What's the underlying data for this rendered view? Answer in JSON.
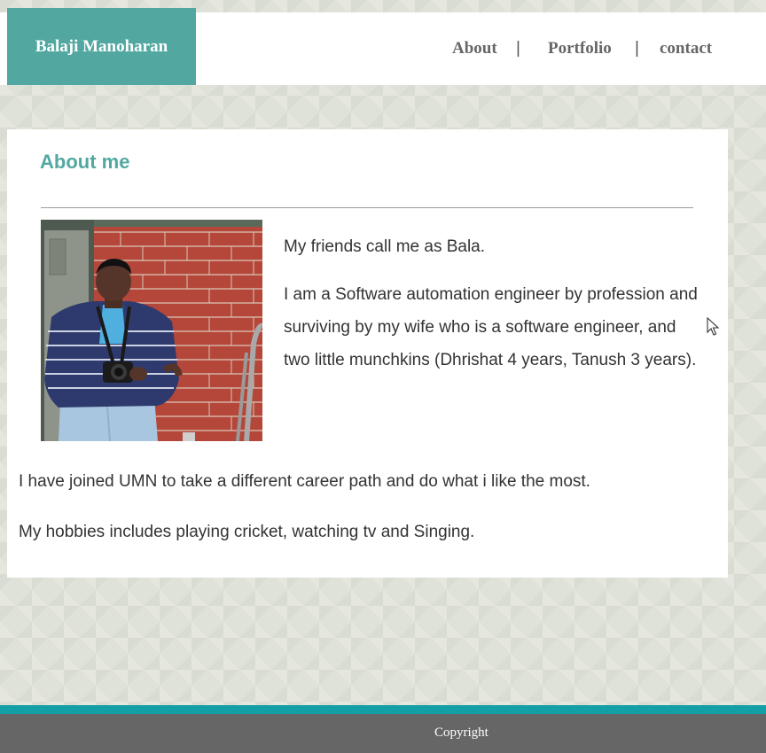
{
  "header": {
    "brand": "Balaji Manoharan",
    "nav": [
      {
        "label": "About"
      },
      {
        "label": "Portfolio"
      },
      {
        "label": "contact"
      }
    ],
    "separator": "|"
  },
  "main": {
    "title": "About me",
    "paragraphs": [
      "My friends call me as Bala.",
      "I am a Software automation engineer by profession and surviving by my wife who is a software engineer, and two little munchkins (Dhrishat 4 years, Tanush 3 years).",
      "I have joined UMN to take a different career path and do what i like the most.",
      "My hobbies includes playing cricket, watching tv and Singing."
    ]
  },
  "footer": {
    "text": "Copyright"
  },
  "colors": {
    "accent": "#52a8a1",
    "footer_stripe": "#12a0a6",
    "footer_bg": "#666666"
  },
  "icons": [
    "mouse-cursor-icon"
  ]
}
